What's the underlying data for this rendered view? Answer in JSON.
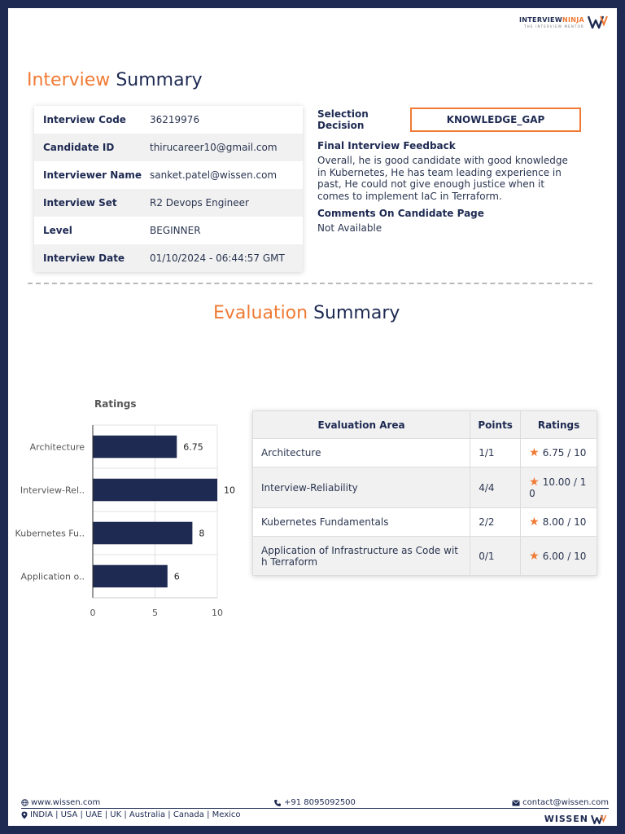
{
  "logo": {
    "name_part1": "INTERVIEW",
    "name_part2": "NINJA",
    "tagline": "THE INTERVIEW MENTOR"
  },
  "interview_summary": {
    "heading_accent": "Interview",
    "heading_main": "Summary",
    "rows": [
      {
        "label": "Interview Code",
        "value": "36219976"
      },
      {
        "label": "Candidate ID",
        "value": "thirucareer10@gmail.com"
      },
      {
        "label": "Interviewer Name",
        "value": "sanket.patel@wissen.com"
      },
      {
        "label": "Interview Set",
        "value": "R2 Devops Engineer"
      },
      {
        "label": "Level",
        "value": "BEGINNER"
      },
      {
        "label": "Interview Date",
        "value": "01/10/2024 - 06:44:57 GMT"
      }
    ]
  },
  "selection": {
    "label_line1": "Selection",
    "label_line2": "Decision",
    "decision": "KNOWLEDGE_GAP",
    "feedback_title": "Final Interview Feedback",
    "feedback_text": "Overall, he is good candidate with good knowledge in Kubernetes, He has team leading experience in past, He could not give enough justice when it comes to implement IaC in Terraform.",
    "comments_title": "Comments On Candidate Page",
    "comments_text": "Not Available"
  },
  "evaluation_summary": {
    "heading_accent": "Evaluation",
    "heading_main": "Summary"
  },
  "chart_data": {
    "type": "bar",
    "orientation": "horizontal",
    "title": "Ratings",
    "categories": [
      "Architecture",
      "Interview-Rel..",
      "Kubernetes Fu..",
      "Application o.."
    ],
    "values": [
      6.75,
      10,
      8,
      6
    ],
    "value_labels": [
      "6.75",
      "10",
      "8",
      "6"
    ],
    "xlim": [
      0,
      10
    ],
    "xticks": [
      "0",
      "5",
      "10"
    ],
    "bar_color": "#1e2a52",
    "grid": true
  },
  "eval_table": {
    "headers": [
      "Evaluation Area",
      "Points",
      "Ratings"
    ],
    "rows": [
      {
        "area": "Architecture",
        "points": "1/1",
        "rating": "6.75 / 10"
      },
      {
        "area": "Interview-Reliability",
        "points": "4/4",
        "rating": "10.00 / 10"
      },
      {
        "area": "Kubernetes Fundamentals",
        "points": "2/2",
        "rating": "8.00 / 10"
      },
      {
        "area": "Application of Infrastructure as Code with Terraform",
        "points": "0/1",
        "rating": "6.00 / 10"
      }
    ]
  },
  "footer": {
    "website": "www.wissen.com",
    "phone": "+91 8095092500",
    "email": "contact@wissen.com",
    "countries": "INDIA | USA | UAE | UK | Australia | Canada | Mexico",
    "brand": "WISSEN"
  },
  "colors": {
    "accent": "#f07a34",
    "navy": "#1e2a52"
  }
}
